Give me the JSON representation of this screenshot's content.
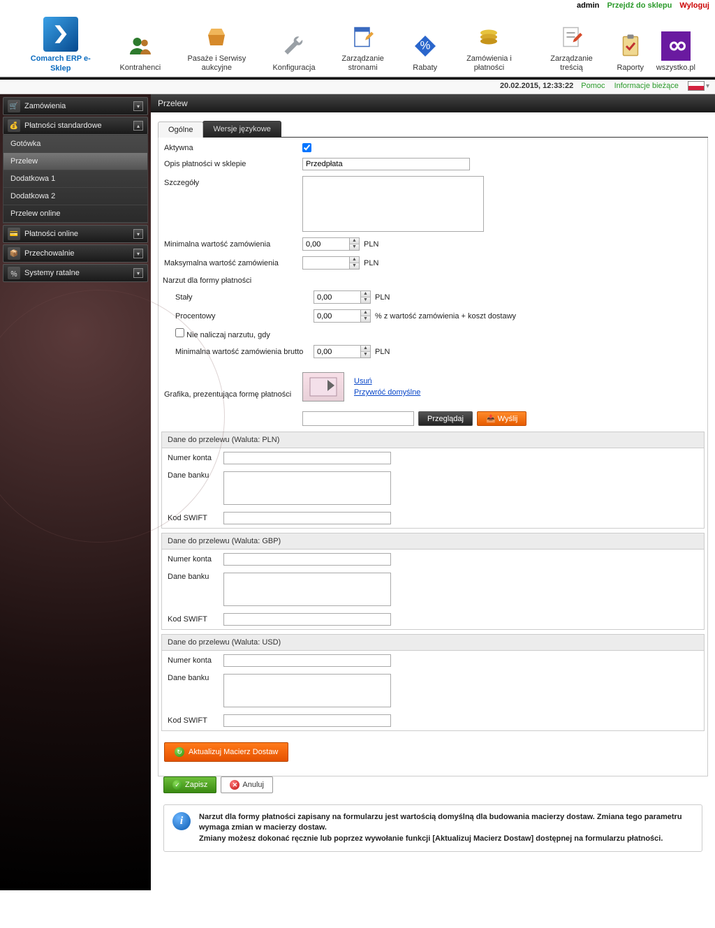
{
  "topbar": {
    "admin": "admin",
    "goto": "Przejdź do sklepu",
    "logout": "Wyloguj"
  },
  "logo": "Comarch ERP e-Sklep",
  "nav": [
    "Kontrahenci",
    "Pasaże i Serwisy aukcyjne",
    "Konfiguracja",
    "Zarządzanie stronami",
    "Rabaty",
    "Zamówienia i płatności",
    "Zarządzanie treścią",
    "Raporty",
    "wszystko.pl"
  ],
  "meta": {
    "datetime": "20.02.2015, 12:33:22",
    "help": "Pomoc",
    "curinfo": "Informacje bieżące"
  },
  "side": {
    "zamowienia": "Zamówienia",
    "pstd": "Płatności standardowe",
    "items": [
      "Gotówka",
      "Przelew",
      "Dodatkowa 1",
      "Dodatkowa 2",
      "Przelew online"
    ],
    "ponline": "Płatności online",
    "przech": "Przechowalnie",
    "sysrat": "Systemy ratalne"
  },
  "page_title": "Przelew",
  "tabs": {
    "t1": "Ogólne",
    "t2": "Wersje językowe"
  },
  "form": {
    "aktywna": "Aktywna",
    "opis_lbl": "Opis płatności w sklepie",
    "opis_val": "Przedpłata",
    "szczegoly": "Szczegóły",
    "min_lbl": "Minimalna wartość zamówienia",
    "min_val": "0,00",
    "pln": "PLN",
    "max_lbl": "Maksymalna wartość zamówienia",
    "max_val": "",
    "narzut_hdr": "Narzut dla formy płatności",
    "staly": "Stały",
    "staly_val": "0,00",
    "proc": "Procentowy",
    "proc_val": "0,00",
    "proc_sfx": "% z wartość zamówienia + koszt dostawy",
    "nienaliczaj": "Nie naliczaj narzutu, gdy",
    "min_brutto": "Minimalna wartość zamówienia brutto",
    "min_brutto_val": "0,00",
    "grafika": "Grafika, prezentująca formę płatności",
    "usun": "Usuń",
    "przywroc": "Przywróć domyślne",
    "browse": "Przeglądaj",
    "upload": "Wyślij"
  },
  "groups": [
    {
      "hdr": "Dane do przelewu (Waluta: PLN)"
    },
    {
      "hdr": "Dane do przelewu (Waluta: GBP)"
    },
    {
      "hdr": "Dane do przelewu (Waluta: USD)"
    }
  ],
  "gl": {
    "numer": "Numer konta",
    "dane": "Dane banku",
    "swift": "Kod SWIFT"
  },
  "btns": {
    "akt": "Aktualizuj Macierz Dostaw",
    "save": "Zapisz",
    "cancel": "Anuluj"
  },
  "info": {
    "l1": "Narzut dla formy płatności zapisany na formularzu jest wartością domyślną dla budowania macierzy dostaw. Zmiana tego parametru wymaga zmian w macierzy dostaw.",
    "l2": "Zmiany możesz dokonać ręcznie lub poprzez wywołanie funkcji [Aktualizuj Macierz Dostaw] dostępnej na formularzu płatności."
  }
}
